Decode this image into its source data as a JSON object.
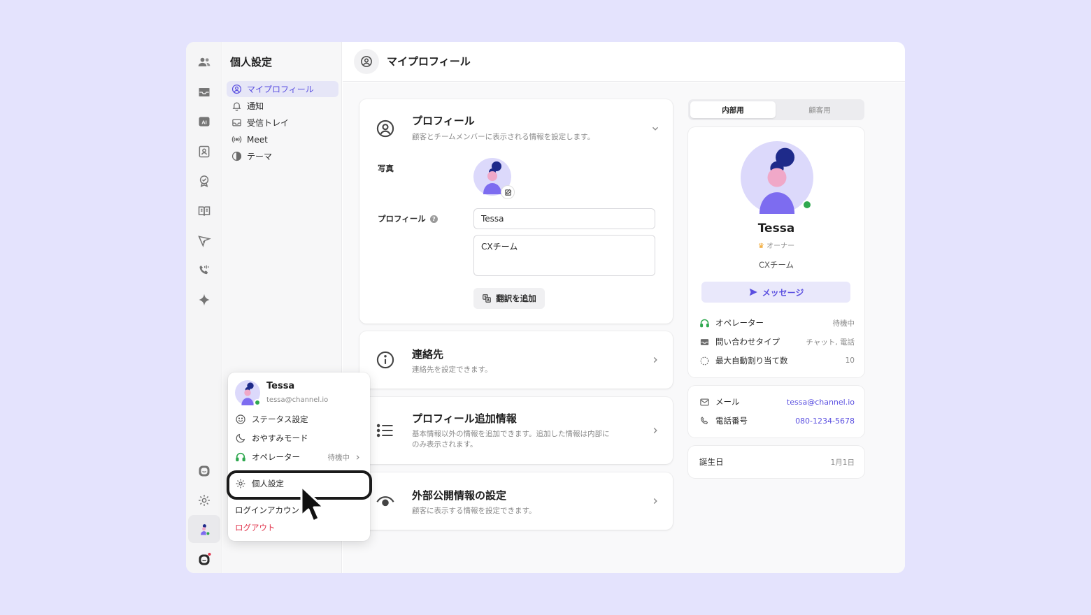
{
  "nav": {
    "title": "個人設定",
    "items": [
      {
        "label": "マイプロフィール",
        "icon": "user-circle-icon",
        "active": true
      },
      {
        "label": "通知",
        "icon": "bell-icon"
      },
      {
        "label": "受信トレイ",
        "icon": "inbox-icon"
      },
      {
        "label": "Meet",
        "icon": "broadcast-icon"
      },
      {
        "label": "テーマ",
        "icon": "contrast-icon"
      }
    ]
  },
  "header": {
    "title": "マイプロフィール"
  },
  "profile_card": {
    "title": "プロフィール",
    "desc": "顧客とチームメンバーに表示される情報を設定します。",
    "photo_label": "写真",
    "profile_label": "プロフィール",
    "name_value": "Tessa",
    "team_value": "CXチーム",
    "translate_button": "翻訳を追加"
  },
  "contact_card": {
    "title": "連絡先",
    "desc": "連絡先を設定できます。"
  },
  "extra_card": {
    "title": "プロフィール追加情報",
    "desc_line1": "基本情報以外の情報を追加できます。追加した情報は内部に",
    "desc_line2": "のみ表示されます。"
  },
  "public_card": {
    "title": "外部公開情報の設定",
    "desc": "顧客に表示する情報を設定できます。"
  },
  "preview": {
    "tabs": [
      "内部用",
      "顧客用"
    ],
    "name": "Tessa",
    "role": "オーナー",
    "team": "CXチーム",
    "message_button": "メッセージ",
    "rows": [
      {
        "label": "オペレーター",
        "value": "待機中"
      },
      {
        "label": "問い合わせタイプ",
        "value": "チャット, 電話"
      },
      {
        "label": "最大自動割り当て数",
        "value": "10"
      }
    ],
    "contact": [
      {
        "label": "メール",
        "value": "tessa@channel.io"
      },
      {
        "label": "電話番号",
        "value": "080-1234-5678"
      }
    ],
    "birthday": {
      "label": "誕生日",
      "value": "1月1日"
    }
  },
  "popup": {
    "name": "Tessa",
    "email": "tessa@channel.io",
    "status": "ステータス設定",
    "sleep": "おやすみモード",
    "operator": "オペレーター",
    "operator_value": "待機中",
    "settings": "個人設定",
    "login_account": "ログインアカウント",
    "logout": "ログアウト"
  },
  "colors": {
    "accent": "#5a4fe0",
    "online": "#2fa84f",
    "logout": "#e0334b",
    "background": "#e4e3fd"
  }
}
